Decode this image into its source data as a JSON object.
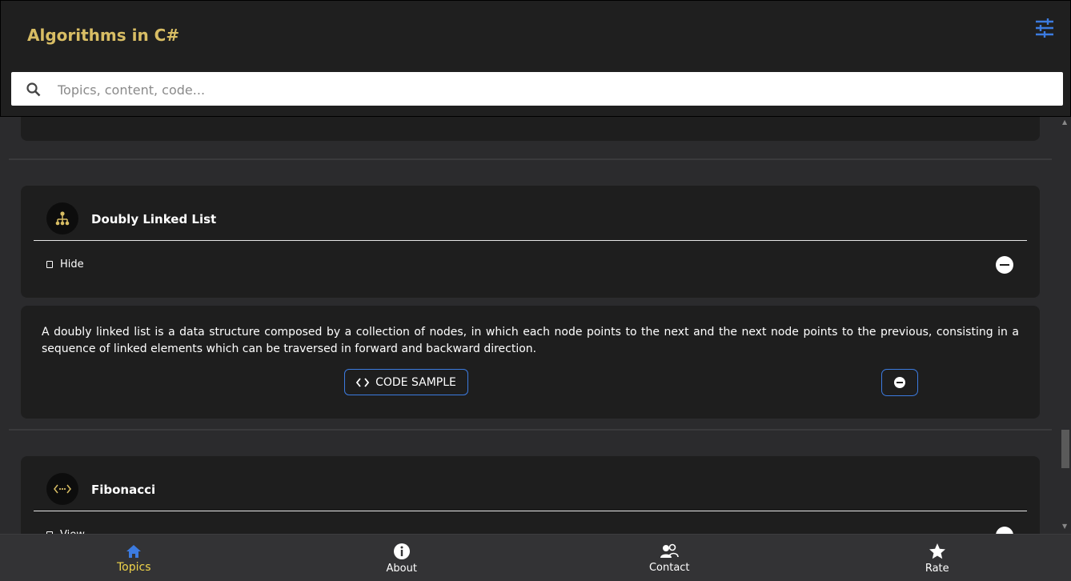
{
  "app": {
    "title": "Algorithms in C#"
  },
  "search": {
    "placeholder": "Topics, content, code..."
  },
  "topics": [
    {
      "title": "Doubly Linked List",
      "toggle_label": "Hide",
      "description": "A doubly linked list is a data structure composed by a collection of nodes, in which each node points to the next and the next node points to the previous, consisting in a sequence of linked elements which can be traversed in forward and backward direction.",
      "code_sample_label": "CODE SAMPLE",
      "icon": "tree-structure-icon"
    },
    {
      "title": "Fibonacci",
      "toggle_label": "View",
      "icon": "code-dots-icon"
    }
  ],
  "bottom_nav": [
    {
      "label": "Topics",
      "icon": "home-icon",
      "active": true
    },
    {
      "label": "About",
      "icon": "info-icon",
      "active": false
    },
    {
      "label": "Contact",
      "icon": "contacts-icon",
      "active": false
    },
    {
      "label": "Rate",
      "icon": "star-icon",
      "active": false
    }
  ],
  "colors": {
    "accent_gold": "#d8bd64",
    "accent_blue": "#3c7be0",
    "active_tab": "#f0d44a",
    "background": "#2b2b2d",
    "card": "#1e1e1e"
  }
}
